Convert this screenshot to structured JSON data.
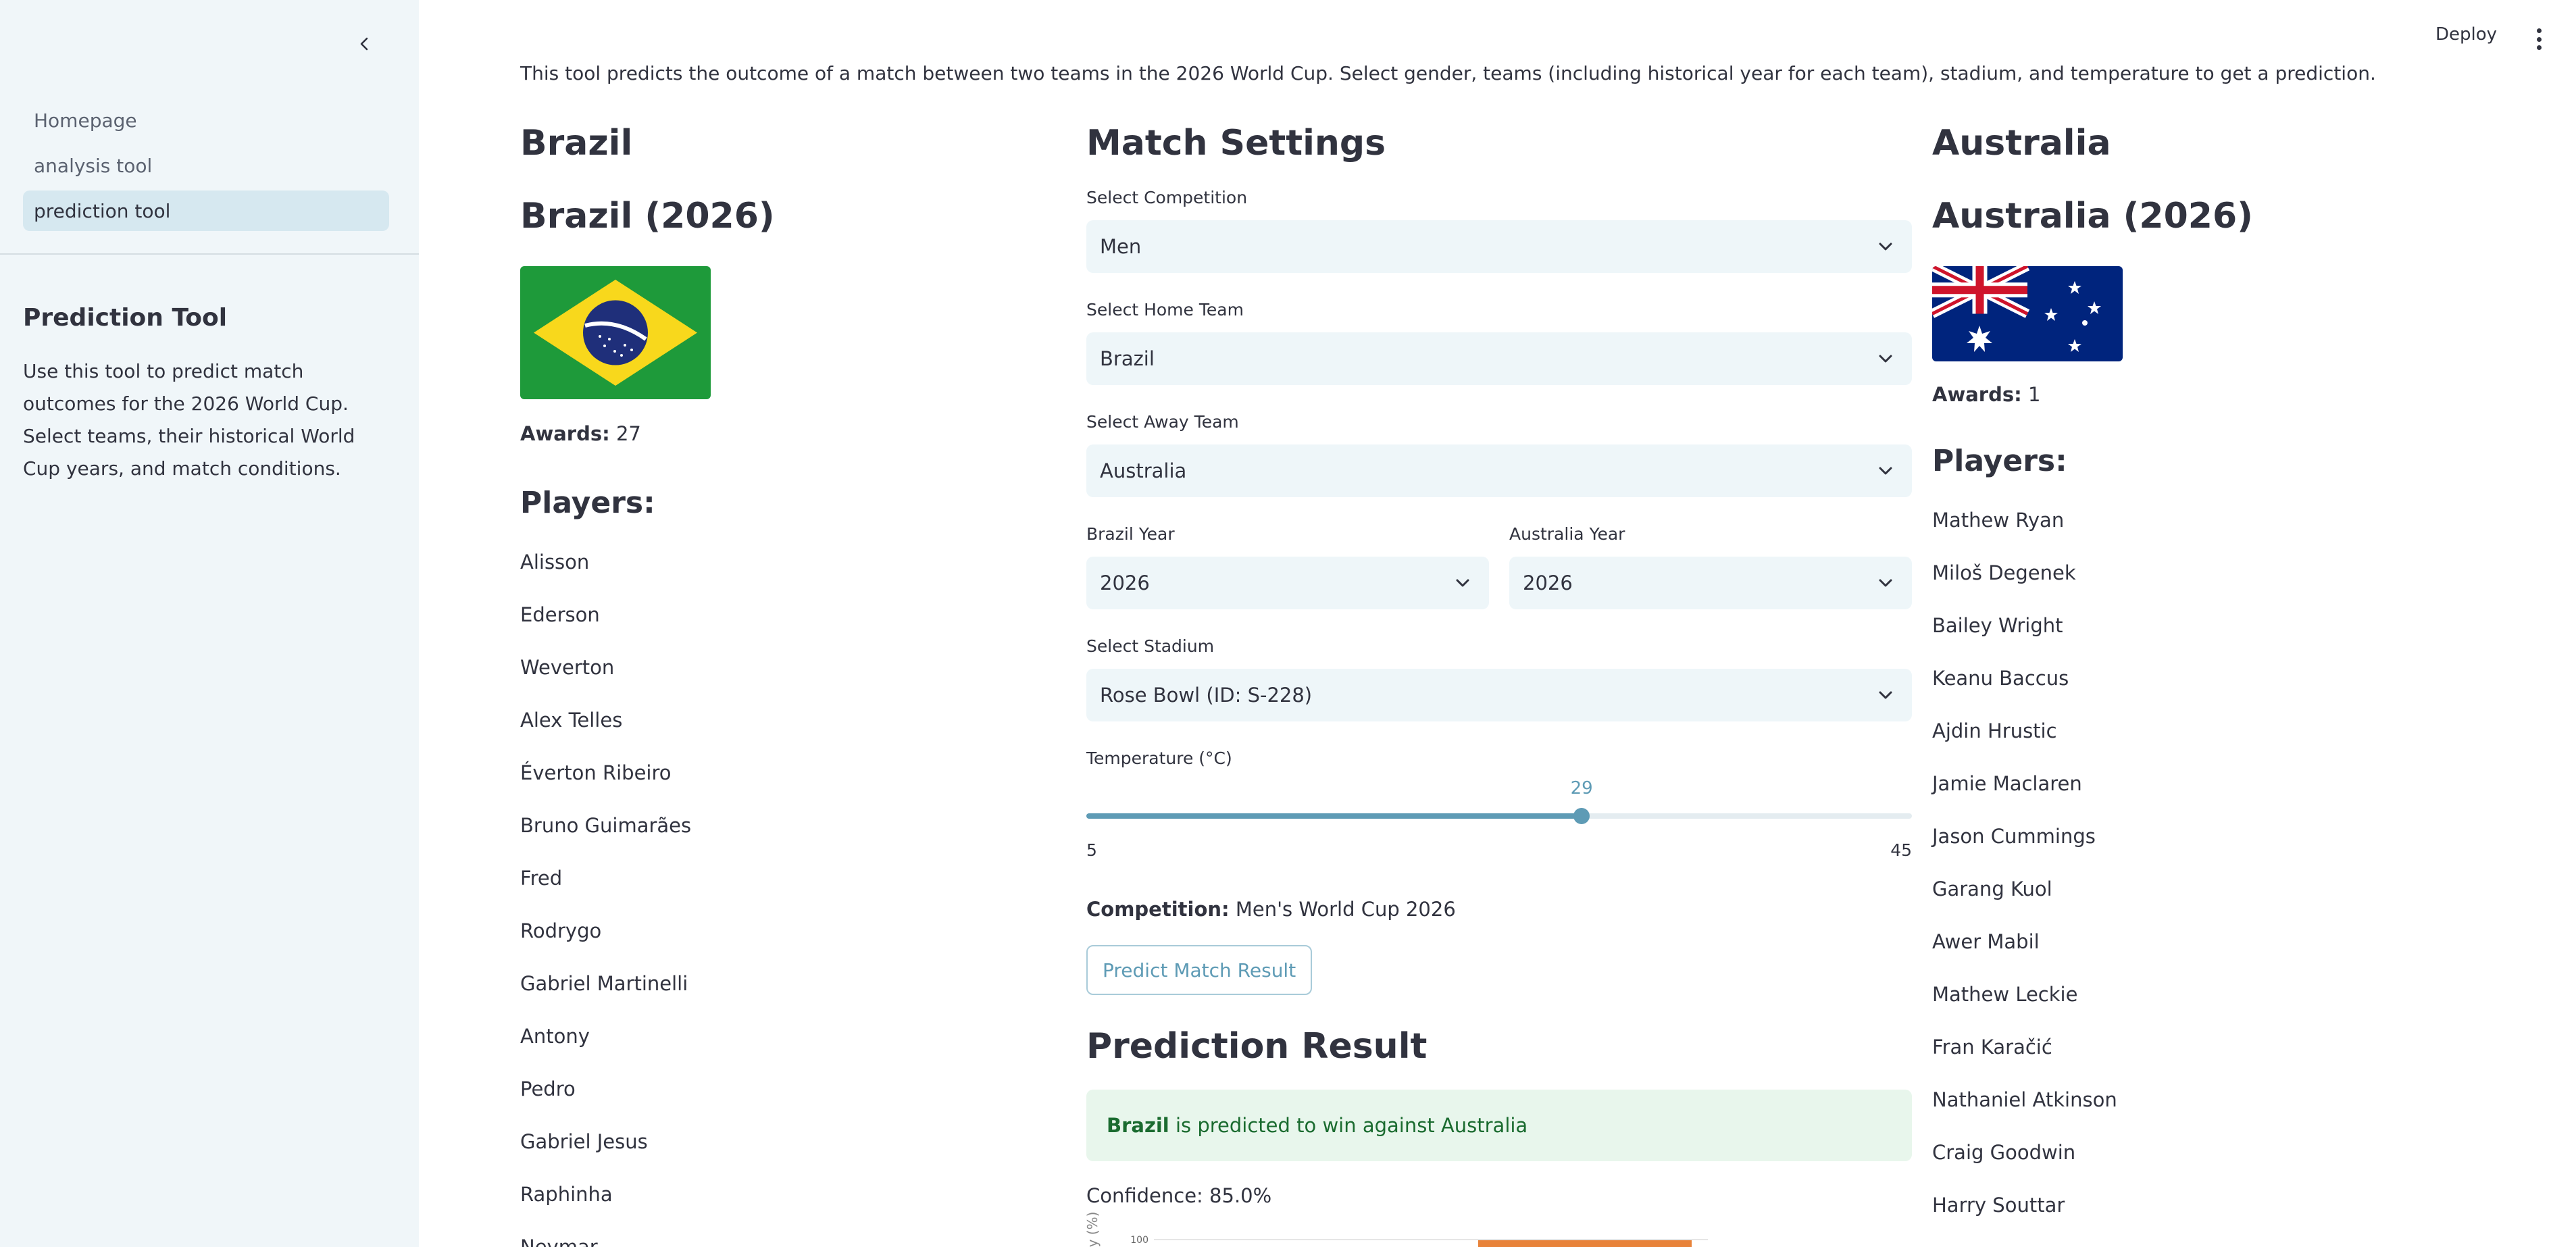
{
  "sidebar": {
    "nav": [
      {
        "label": "Homepage",
        "active": false
      },
      {
        "label": "analysis tool",
        "active": false
      },
      {
        "label": "prediction tool",
        "active": true
      }
    ],
    "title": "Prediction Tool",
    "description": "Use this tool to predict match outcomes for the 2026 World Cup. Select teams, their historical World Cup years, and match conditions."
  },
  "topbar": {
    "deploy_label": "Deploy"
  },
  "intro": "This tool predicts the outcome of a match between two teams in the 2026 World Cup. Select gender, teams (including historical year for each team), stadium, and temperature to get a prediction.",
  "home_team": {
    "name": "Brazil",
    "year_title": "Brazil (2026)",
    "flag": "brazil-flag",
    "awards_label": "Awards:",
    "awards_value": "27",
    "players_heading": "Players:",
    "players": [
      "Alisson",
      "Ederson",
      "Weverton",
      "Alex Telles",
      "Éverton Ribeiro",
      "Bruno Guimarães",
      "Fred",
      "Rodrygo",
      "Gabriel Martinelli",
      "Antony",
      "Pedro",
      "Gabriel Jesus",
      "Raphinha",
      "Neymar"
    ]
  },
  "away_team": {
    "name": "Australia",
    "year_title": "Australia (2026)",
    "flag": "australia-flag",
    "awards_label": "Awards:",
    "awards_value": "1",
    "players_heading": "Players:",
    "players": [
      "Mathew Ryan",
      "Miloš Degenek",
      "Bailey Wright",
      "Keanu Baccus",
      "Ajdin Hrustic",
      "Jamie Maclaren",
      "Jason Cummings",
      "Garang Kuol",
      "Awer Mabil",
      "Mathew Leckie",
      "Fran Karačić",
      "Nathaniel Atkinson",
      "Craig Goodwin",
      "Harry Souttar"
    ]
  },
  "settings": {
    "title": "Match Settings",
    "competition_label": "Select Competition",
    "competition_value": "Men",
    "home_label": "Select Home Team",
    "home_value": "Brazil",
    "away_label": "Select Away Team",
    "away_value": "Australia",
    "home_year_label": "Brazil Year",
    "home_year_value": "2026",
    "away_year_label": "Australia Year",
    "away_year_value": "2026",
    "stadium_label": "Select Stadium",
    "stadium_value": "Rose Bowl (ID: S-228)",
    "temperature_label": "Temperature (°C)",
    "temperature": {
      "min": "5",
      "max": "45",
      "value": "29",
      "fraction": 0.6
    },
    "competition_key": "Competition:",
    "competition_text": "Men's World Cup 2026",
    "predict_button": "Predict Match Result"
  },
  "result": {
    "title": "Prediction Result",
    "winner": "Brazil",
    "message": " is predicted to win against Australia",
    "confidence": "Confidence: 85.0%"
  },
  "chart_data": {
    "type": "bar",
    "ylabel": "y (%)",
    "ytick_visible": "100",
    "bar_color": "#e8833a"
  },
  "colors": {
    "accent": "#5e9bb5",
    "sidebar_bg": "#f0f6f9",
    "select_bg": "#eef6f9",
    "success_bg": "#e8f6ec",
    "success_text": "#1a6b2f"
  }
}
